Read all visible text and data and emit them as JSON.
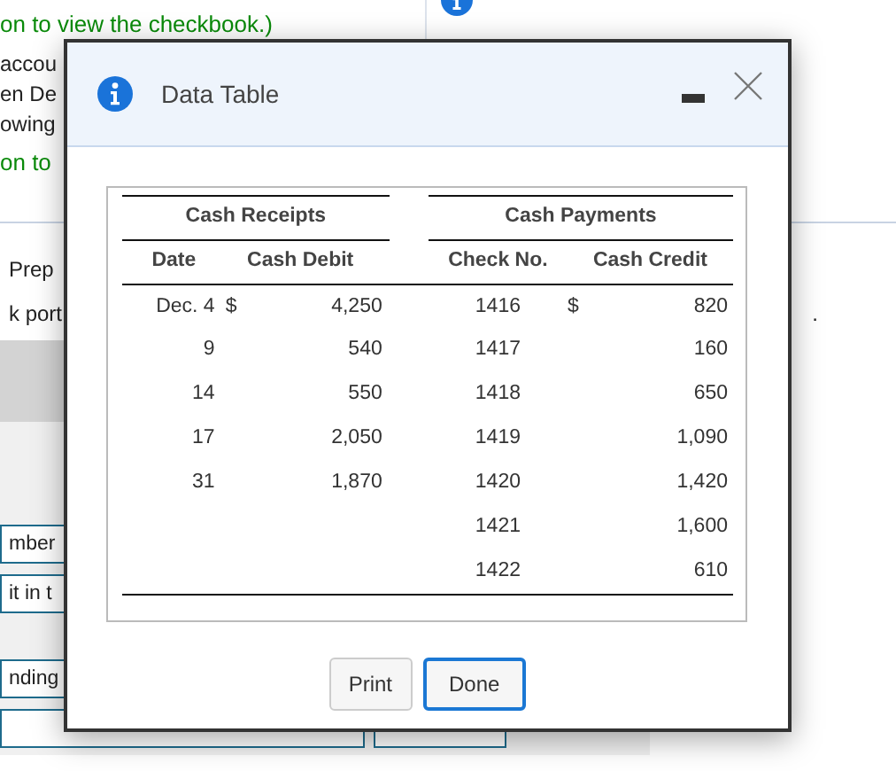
{
  "background": {
    "top_left_text": "on to view the checkbook.)",
    "left_lines": [
      {
        "text": "accou",
        "kind": "plain"
      },
      {
        "text": "en De",
        "kind": "plain"
      },
      {
        "text": "owing",
        "kind": "plain"
      },
      {
        "text": "on to",
        "kind": "link"
      }
    ],
    "middle_lines": [
      "Prep",
      "k port"
    ],
    "right_period": ".",
    "fields": [
      {
        "value": "mber"
      },
      {
        "value": "it in t"
      },
      {
        "value": "nding"
      }
    ]
  },
  "dialog": {
    "title": "Data Table",
    "groups": [
      "Cash Receipts",
      "Cash Payments"
    ],
    "columns": [
      "Date",
      "Cash Debit",
      "Check No.",
      "Cash Credit"
    ],
    "rows": [
      {
        "date": "Dec. 4",
        "debit_symbol": "$",
        "debit": "4,250",
        "check_no": "1416",
        "credit_symbol": "$",
        "credit": "820"
      },
      {
        "date": "9",
        "debit": "540",
        "check_no": "1417",
        "credit": "160"
      },
      {
        "date": "14",
        "debit": "550",
        "check_no": "1418",
        "credit": "650"
      },
      {
        "date": "17",
        "debit": "2,050",
        "check_no": "1419",
        "credit": "1,090"
      },
      {
        "date": "31",
        "debit": "1,870",
        "check_no": "1420",
        "credit": "1,420"
      },
      {
        "check_no": "1421",
        "credit": "1,600"
      },
      {
        "check_no": "1422",
        "credit": "610"
      }
    ],
    "buttons": [
      {
        "label": "Print",
        "selected": false
      },
      {
        "label": "Done",
        "selected": true
      }
    ]
  }
}
